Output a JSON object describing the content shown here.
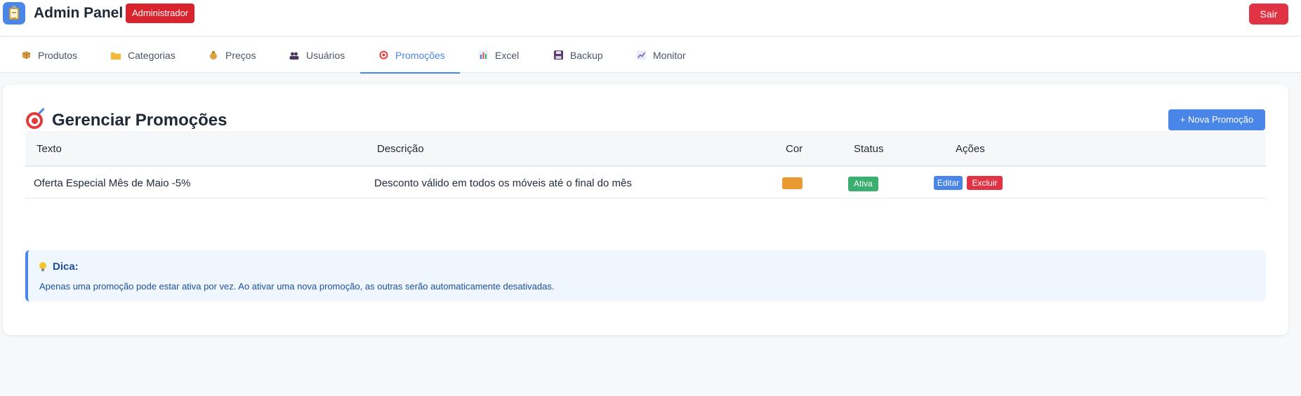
{
  "header": {
    "title": "Admin Panel",
    "role_badge": "Administrador",
    "logout_label": "Sair"
  },
  "tabs": [
    {
      "label": "Produtos",
      "icon": "package-icon"
    },
    {
      "label": "Categorias",
      "icon": "folder-icon"
    },
    {
      "label": "Preços",
      "icon": "money-bag-icon"
    },
    {
      "label": "Usuários",
      "icon": "users-icon"
    },
    {
      "label": "Promoções",
      "icon": "target-icon",
      "active": true
    },
    {
      "label": "Excel",
      "icon": "bar-chart-icon"
    },
    {
      "label": "Backup",
      "icon": "floppy-disk-icon"
    },
    {
      "label": "Monitor",
      "icon": "trend-chart-icon"
    }
  ],
  "main": {
    "title": "Gerenciar Promoções",
    "new_button_label": "+ Nova Promoção",
    "table": {
      "headers": [
        "Texto",
        "Descrição",
        "Cor",
        "Status",
        "Ações"
      ],
      "rows": [
        {
          "texto": "Oferta Especial Mês de Maio -5%",
          "descricao": "Desconto válido em todos os móveis até o final do mês",
          "cor": "#e99a30",
          "status": "Ativa",
          "edit_label": "Editar",
          "delete_label": "Excluir"
        }
      ]
    },
    "tip": {
      "title": "Dica:",
      "text": "Apenas uma promoção pode estar ativa por vez. Ao ativar uma nova promoção, as outras serão automaticamente desativadas."
    }
  },
  "colors": {
    "accent": "#4a86e8",
    "danger": "#e03444",
    "success": "#3aaf6f"
  }
}
